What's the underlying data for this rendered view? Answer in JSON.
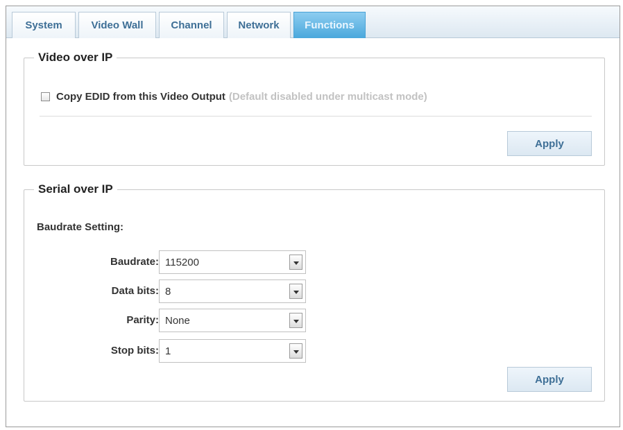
{
  "tabs": [
    {
      "label": "System",
      "active": false
    },
    {
      "label": "Video Wall",
      "active": false
    },
    {
      "label": "Channel",
      "active": false
    },
    {
      "label": "Network",
      "active": false
    },
    {
      "label": "Functions",
      "active": true
    }
  ],
  "video_over_ip": {
    "legend": "Video over IP",
    "copy_edid_label": "Copy EDID from this Video Output",
    "copy_edid_note": "(Default disabled under multicast mode)",
    "copy_edid_checked": false,
    "apply_label": "Apply"
  },
  "serial_over_ip": {
    "legend": "Serial over IP",
    "baudrate_heading": "Baudrate Setting:",
    "fields": {
      "baudrate": {
        "label": "Baudrate:",
        "value": "115200"
      },
      "data_bits": {
        "label": "Data bits:",
        "value": "8"
      },
      "parity": {
        "label": "Parity:",
        "value": "None"
      },
      "stop_bits": {
        "label": "Stop bits:",
        "value": "1"
      }
    },
    "apply_label": "Apply"
  },
  "colors": {
    "tab_active": "#4aa8dc",
    "tab_text": "#3e6f96",
    "note_text": "#c2c2c2"
  },
  "icons": {
    "dropdown": "chevron-down-icon",
    "checkbox": "checkbox-icon"
  }
}
